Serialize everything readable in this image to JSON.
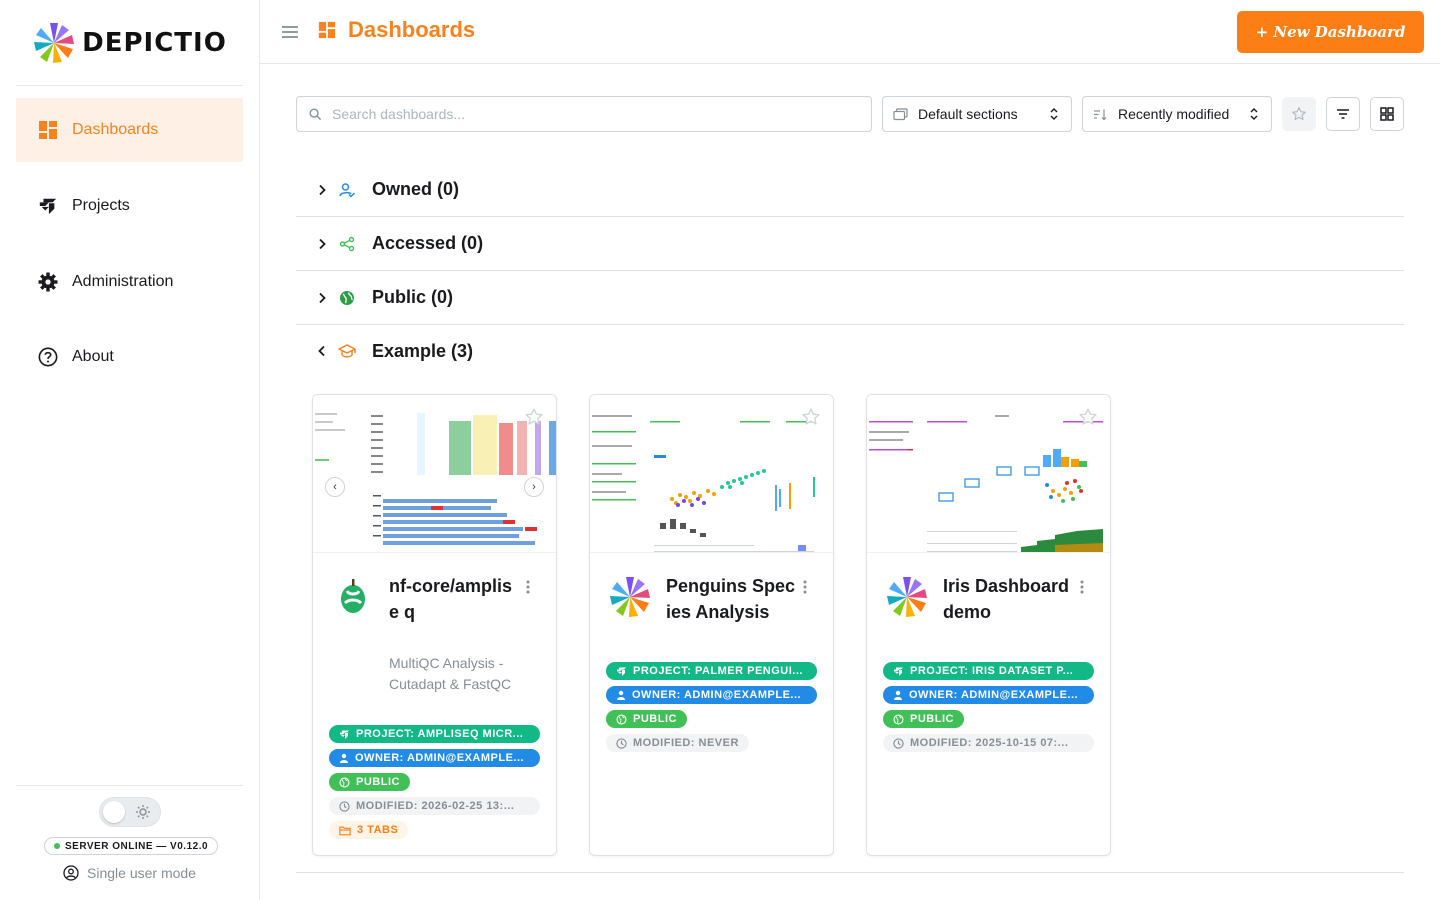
{
  "brand": {
    "name": "DEPICTIO"
  },
  "sidebar": {
    "items": [
      {
        "label": "Dashboards",
        "icon": "dashboard-icon",
        "active": true
      },
      {
        "label": "Projects",
        "icon": "projects-icon",
        "active": false
      },
      {
        "label": "Administration",
        "icon": "gear-icon",
        "active": false
      },
      {
        "label": "About",
        "icon": "help-circle-icon",
        "active": false
      }
    ],
    "footer": {
      "status": "SERVER ONLINE — V0.12.0",
      "mode": "Single user mode"
    }
  },
  "header": {
    "title": "Dashboards",
    "new_button": "+ New Dashboard"
  },
  "toolbar": {
    "search_placeholder": "Search dashboards...",
    "sections_select": "Default sections",
    "sort_select": "Recently modified"
  },
  "sections": [
    {
      "label": "Owned (0)",
      "expanded": false,
      "color": "#228be6"
    },
    {
      "label": "Accessed (0)",
      "expanded": false,
      "color": "#40c057"
    },
    {
      "label": "Public (0)",
      "expanded": false,
      "color": "#2f9e44"
    },
    {
      "label": "Example (3)",
      "expanded": true,
      "color": "#fd7e14"
    }
  ],
  "cards": [
    {
      "title": "nf-core/amplise q",
      "subtitle": "MultiQC Analysis - Cutadapt & FastQC",
      "project": "PROJECT: AMPLISEQ MICR...",
      "owner": "OWNER: ADMIN@EXAMPLE...",
      "visibility": "PUBLIC",
      "modified": "MODIFIED: 2026-02-25 13:...",
      "tabs": "3 TABS"
    },
    {
      "title": "Penguins Species Analysis",
      "subtitle": "",
      "project": "PROJECT: PALMER PENGUI...",
      "owner": "OWNER: ADMIN@EXAMPLE...",
      "visibility": "PUBLIC",
      "modified": "MODIFIED: NEVER"
    },
    {
      "title": "Iris Dashboard demo",
      "subtitle": "",
      "project": "PROJECT: IRIS DATASET P...",
      "owner": "OWNER: ADMIN@EXAMPLE...",
      "visibility": "PUBLIC",
      "modified": "MODIFIED: 2025-10-15 07:..."
    }
  ],
  "colors": {
    "accent": "#fd7e14",
    "accent_text": "#f6831f",
    "active_bg": "#fff0e6",
    "project_badge": "#12b886",
    "owner_badge": "#228be6",
    "public_badge": "#40c057"
  }
}
